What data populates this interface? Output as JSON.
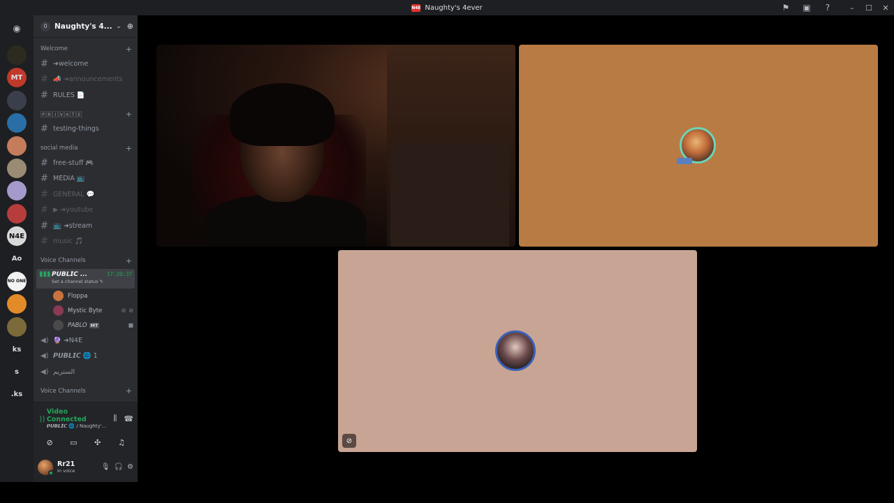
{
  "window": {
    "title": "Naughty's 4ever",
    "logo_text": "N4E"
  },
  "rail": {
    "home_icon": "discord-icon",
    "servers": [
      {
        "color": "#2d2a1f",
        "text": ""
      },
      {
        "color": "#c0392b",
        "text": "MT"
      },
      {
        "color": "#3b3f4b",
        "text": ""
      },
      {
        "color": "#2a6ea6",
        "text": ""
      },
      {
        "color": "#c57c5b",
        "text": ""
      },
      {
        "color": "#9a8b74",
        "text": ""
      },
      {
        "color": "#a49acb",
        "text": ""
      },
      {
        "color": "#b73d3d",
        "text": ""
      },
      {
        "color": "#d9d9d9",
        "text": "N4E"
      },
      {
        "color": "#1e1f22",
        "text": "Ao"
      },
      {
        "color": "#f2f2f2",
        "text": "NO ONE"
      },
      {
        "color": "#e28b28",
        "text": ""
      },
      {
        "color": "#7b6a3a",
        "text": ""
      },
      {
        "color": "#1e1f22",
        "text": "ks"
      },
      {
        "color": "#1e1f22",
        "text": "s"
      },
      {
        "color": "#1e1f22",
        "text": ".ks"
      }
    ]
  },
  "server": {
    "boost_count": "0",
    "name": "Naughty's 4..."
  },
  "categories": {
    "welcome": {
      "name": "Welcome",
      "channels": [
        "➜welcome",
        "📣 ➜announcements",
        "RULES 📄"
      ]
    },
    "private": {
      "name": "🄿🅁🄸🅅🄰🅃🄴",
      "channels": [
        "testing-things"
      ]
    },
    "social": {
      "name": "social media",
      "channels": [
        "free-stuff 🎮",
        "MEDIA 📺",
        "GENERAL 💬",
        "▶ ➜youtube",
        "📺 ➜stream",
        "music 🎵"
      ]
    },
    "voice": {
      "name": "Voice Channels",
      "active": {
        "name": "𝙋𝙐𝘽𝙇𝙄𝘾 ...",
        "time": "17:20:37",
        "status": "Set a channel status ✎"
      },
      "members": [
        {
          "name": "Floppa",
          "avatar_color": "#c9733e",
          "tag": ""
        },
        {
          "name": "Mystic Byte",
          "avatar_color": "#8a3a52",
          "tag": ""
        },
        {
          "name": "PABLO",
          "avatar_color": "#4a4a4a",
          "tag": "MT"
        }
      ],
      "other_channels": [
        "🔮 ➜N4E",
        "𝙋𝙐𝘽𝙇𝙄𝘾 🌐 1",
        "الستريم"
      ],
      "next_category": "Voice Channels"
    }
  },
  "connection": {
    "title": "Video Connected",
    "subtitle": "𝙋𝙐𝘽𝙇𝙄𝘾 🌐 / Naughty'..."
  },
  "user": {
    "name": "Rr21",
    "status": "In voice"
  },
  "colors": {
    "accent_green": "#23a55a",
    "tile_orange": "#b97b44",
    "tile_pink": "#c8a494"
  }
}
